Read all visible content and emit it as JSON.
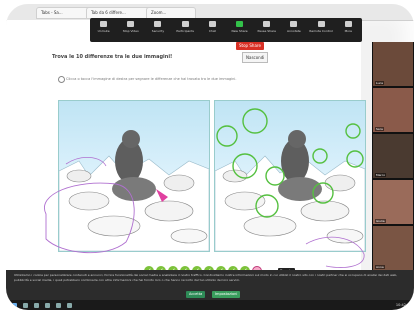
{
  "browser": {
    "tabs": [
      "Tabs - Sa...",
      "Tab da 6 differe...",
      "Zoom..."
    ]
  },
  "zoom_toolbar": {
    "items": [
      {
        "label": "Unmute",
        "icon": "microphone-icon"
      },
      {
        "label": "Stop Video",
        "icon": "video-camera-icon"
      },
      {
        "label": "Security",
        "icon": "shield-icon"
      },
      {
        "label": "Participants",
        "icon": "participants-icon"
      },
      {
        "label": "Chat",
        "icon": "chat-icon"
      },
      {
        "label": "New Share",
        "icon": "share-screen-icon"
      },
      {
        "label": "Pause Share",
        "icon": "pause-icon"
      },
      {
        "label": "Annotate",
        "icon": "pencil-icon"
      },
      {
        "label": "Remote Control",
        "icon": "remote-control-icon"
      },
      {
        "label": "More",
        "icon": "more-icon"
      }
    ],
    "stop_share_label": "Stop Share"
  },
  "puzzle": {
    "question": "Trova le 10 differenze tra le due immagini!",
    "hide_button": "Nascondi",
    "instruction": "Clicca o tocca l'immagine di destra per segnare le differenze che hai trovato tra le due immagini.",
    "found_count": 9,
    "total_count": 10,
    "check_glyph": "✓",
    "tip": "Trovato"
  },
  "cookie_notice": {
    "text": "Utilizziamo i cookie per personalizzare contenuti e annunci, fornire funzionalità dei social media e analizzare il nostro traffico. Condividiamo inoltre informazioni sul modo in cui utilizzi il nostro sito con i nostri partner che si occupano di analisi dei dati web, pubblicità e social media, i quali potrebbero combinarle con altre informazioni che hai fornito loro o che hanno raccolto dal tuo utilizzo dei loro servizi.",
    "accept_label": "Accetta",
    "settings_label": "Impostazioni"
  },
  "taskbar": {
    "clock": "10:42"
  },
  "gallery": {
    "participants": [
      {
        "name": "Luca",
        "color": "#6b4a3a"
      },
      {
        "name": "Sara",
        "color": "#8a5a4a"
      },
      {
        "name": "Marco",
        "color": "#4a3a30"
      },
      {
        "name": "Giulia",
        "color": "#9a6b5a"
      },
      {
        "name": "Anna",
        "color": "#7a5544"
      }
    ]
  },
  "colors": {
    "annotation_purple": "#b070d0",
    "annotation_green": "#55c040",
    "marker_pink": "#e040a0"
  }
}
